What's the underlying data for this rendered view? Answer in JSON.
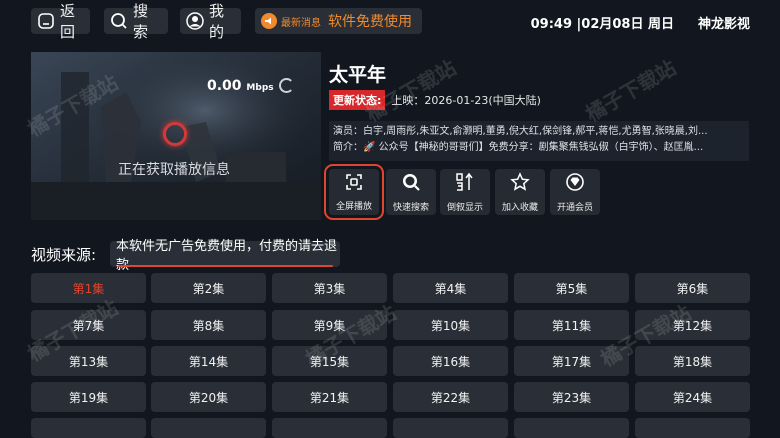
{
  "topbar": {
    "back_label": "返回",
    "search_label": "搜索",
    "mine_label": "我的",
    "notice_tag": "最新消息",
    "notice_text": "软件免费使用",
    "time": "09:49 |02月08日 周日",
    "brand": "神龙影视"
  },
  "player": {
    "speed_value": "0.00",
    "speed_unit": "Mbps",
    "loading_text": "正在获取播放信息"
  },
  "info": {
    "title": "太平年",
    "update_badge": "更新状态:",
    "update_text": "上映：2026-01-23(中国大陆)",
    "cast": "演员：白宇,周雨彤,朱亚文,俞灏明,董勇,倪大红,保剑锋,郝平,蒋恺,尤勇智,张晓晨,刘...",
    "intro": "简介：🚀 公众号【神秘的哥哥们】免费分享：剧集聚焦钱弘俶（白宇饰）、赵匡胤..."
  },
  "actions": [
    {
      "label": "全屏播放",
      "icon": "fullscreen-icon"
    },
    {
      "label": "快速搜索",
      "icon": "search-icon"
    },
    {
      "label": "倒叙显示",
      "icon": "sort-icon"
    },
    {
      "label": "加入收藏",
      "icon": "star-icon"
    },
    {
      "label": "开通会员",
      "icon": "vip-icon"
    }
  ],
  "source": {
    "label": "视频来源:",
    "notice": "本软件无广告免费使用，付费的请去退款"
  },
  "episodes": [
    "第1集",
    "第2集",
    "第3集",
    "第4集",
    "第5集",
    "第6集",
    "第7集",
    "第8集",
    "第9集",
    "第10集",
    "第11集",
    "第12集",
    "第13集",
    "第14集",
    "第15集",
    "第16集",
    "第17集",
    "第18集",
    "第19集",
    "第20集",
    "第21集",
    "第22集",
    "第23集",
    "第24集"
  ],
  "watermark": "橘子下载站",
  "colors": {
    "background": "#12171f",
    "accent_red": "#e0452e",
    "notice_orange": "#f08a2c",
    "badge_red": "#d6282b",
    "button_bg": "#2a2f37"
  }
}
